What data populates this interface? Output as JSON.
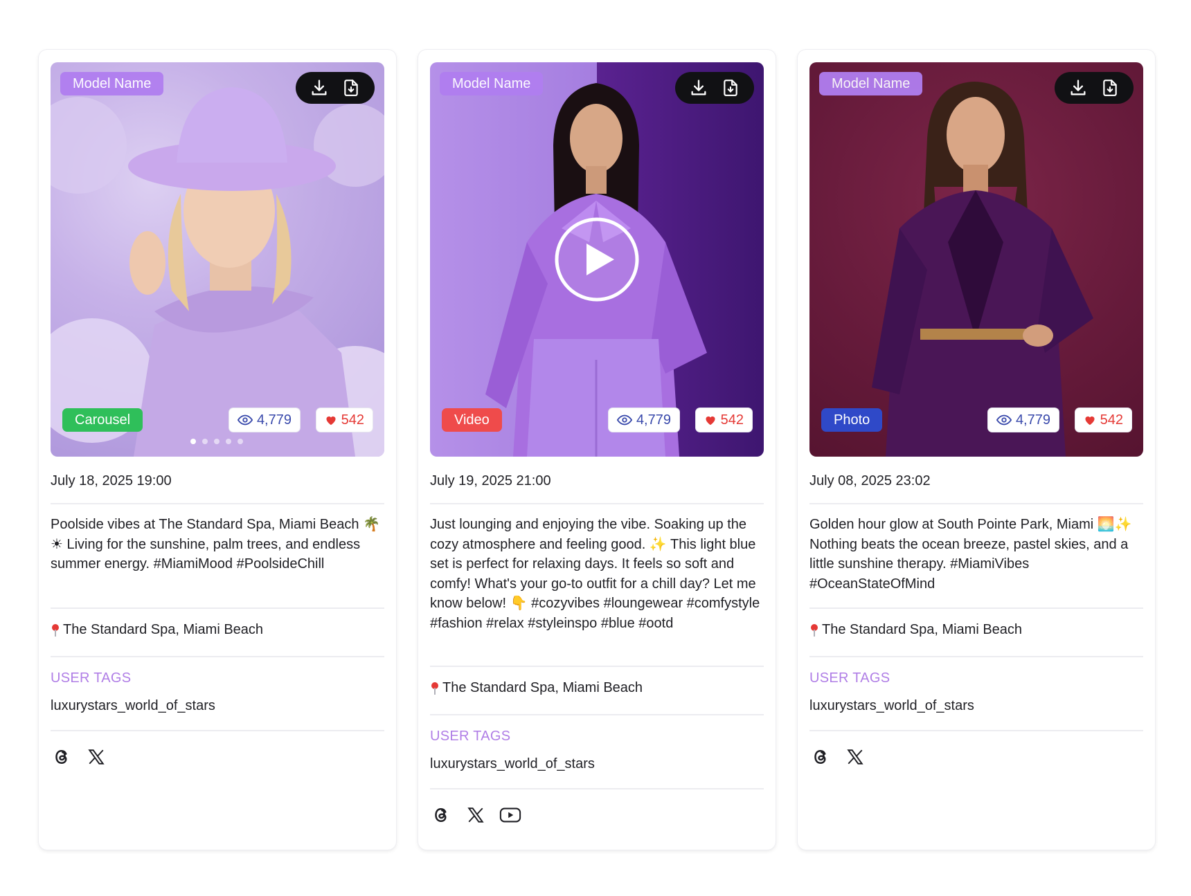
{
  "cards": [
    {
      "model_name": "Model Name",
      "type": "Carousel",
      "type_color": "#2fbf5a",
      "views": "4,779",
      "likes": "542",
      "date": "July 18, 2025 19:00",
      "caption": "Poolside vibes at The Standard Spa, Miami Beach 🌴☀ Living for the sunshine, palm trees, and endless summer energy. #MiamiMood #PoolsideChill",
      "location": "The Standard Spa, Miami Beach",
      "tags_label": "USER TAGS",
      "tags_value": "luxurystars_world_of_stars",
      "socials": [
        "threads-icon",
        "x-icon"
      ],
      "carousel_dots": 5
    },
    {
      "model_name": "Model Name",
      "type": "Video",
      "type_color": "#ef4b4b",
      "views": "4,779",
      "likes": "542",
      "date": "July 19, 2025 21:00",
      "caption": "Just lounging and enjoying the vibe. Soaking up the cozy atmosphere and feeling good. ✨ This light blue set is perfect for relaxing days. It feels so soft and comfy! What's your go-to outfit for a chill day? Let me know below! 👇 #cozyvibes #loungewear #comfystyle #fashion #relax #styleinspo #blue #ootd",
      "location": "The Standard Spa, Miami Beach",
      "tags_label": "USER TAGS",
      "tags_value": "luxurystars_world_of_stars",
      "socials": [
        "threads-icon",
        "x-icon",
        "youtube-icon"
      ]
    },
    {
      "model_name": "Model Name",
      "type": "Photo",
      "type_color": "#2f49c8",
      "views": "4,779",
      "likes": "542",
      "date": "July 08, 2025 23:02",
      "caption": "Golden hour glow at South Pointe Park, Miami 🌅✨ Nothing beats the ocean breeze, pastel skies, and a little sunshine therapy. #MiamiVibes #OceanStateOfMind",
      "location": "The Standard Spa, Miami Beach",
      "tags_label": "USER TAGS",
      "tags_value": "luxurystars_world_of_stars",
      "socials": [
        "threads-icon",
        "x-icon"
      ]
    }
  ],
  "colors": {
    "accent_purple": "#b07ef0",
    "views_blue": "#3949ab",
    "likes_red": "#e53935"
  }
}
